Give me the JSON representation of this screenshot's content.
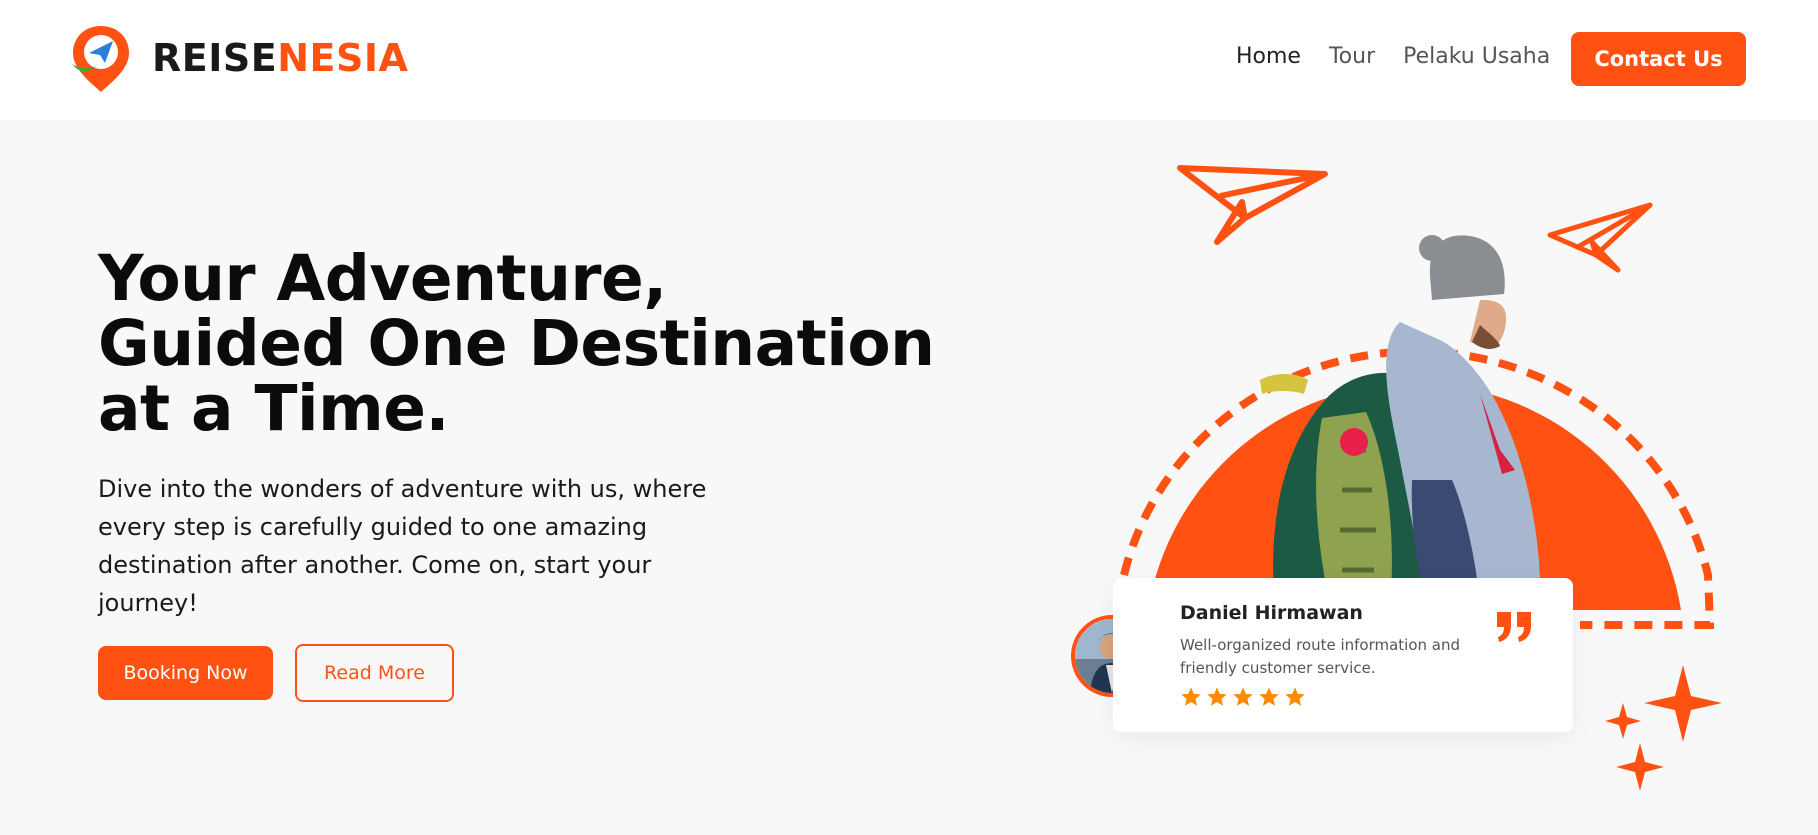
{
  "brand": {
    "name_part1": "REISE",
    "name_part2": "NESIA",
    "colors": {
      "primary": "#ff5212",
      "dark": "#1a1a1a",
      "logo_green": "#3aa935",
      "logo_blue": "#2b7fd8"
    }
  },
  "nav": {
    "links": [
      {
        "label": "Home",
        "active": true
      },
      {
        "label": "Tour",
        "active": false
      },
      {
        "label": "Pelaku Usaha",
        "active": false
      }
    ],
    "contact_label": "Contact Us"
  },
  "hero": {
    "title_line1": "Your Adventure,",
    "title_line2": "Guided One Destination",
    "title_line3": "at a Time.",
    "description": "Dive into the wonders of adventure with us, where every step is carefully guided to one amazing destination after another. Come on, start your journey!",
    "booking_label": "Booking Now",
    "readmore_label": "Read More"
  },
  "review": {
    "name": "Daniel Hirmawan",
    "text": "Well-organized route information and friendly customer service.",
    "rating": 5,
    "icons": {
      "quote": "quote-icon",
      "star": "star-icon"
    }
  },
  "decor": {
    "icons": [
      "paper-plane-icon",
      "sparkle-icon"
    ]
  }
}
